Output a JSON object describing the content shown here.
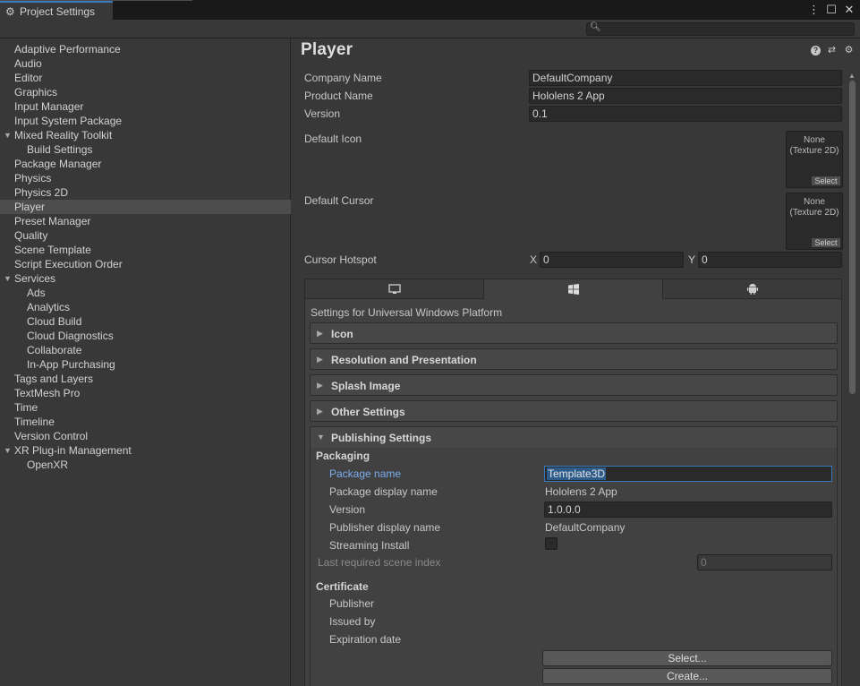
{
  "window": {
    "tab_title": "Project Settings",
    "controls": [
      "⋮",
      "☐",
      "✕"
    ]
  },
  "search": {
    "value": "",
    "placeholder": ""
  },
  "sidebar": {
    "items": [
      {
        "label": "Adaptive Performance",
        "indent": 0
      },
      {
        "label": "Audio",
        "indent": 0
      },
      {
        "label": "Editor",
        "indent": 0
      },
      {
        "label": "Graphics",
        "indent": 0
      },
      {
        "label": "Input Manager",
        "indent": 0
      },
      {
        "label": "Input System Package",
        "indent": 0
      },
      {
        "label": "Mixed Reality Toolkit",
        "indent": 0,
        "expanded": true
      },
      {
        "label": "Build Settings",
        "indent": 1
      },
      {
        "label": "Package Manager",
        "indent": 0
      },
      {
        "label": "Physics",
        "indent": 0
      },
      {
        "label": "Physics 2D",
        "indent": 0
      },
      {
        "label": "Player",
        "indent": 0,
        "selected": true
      },
      {
        "label": "Preset Manager",
        "indent": 0
      },
      {
        "label": "Quality",
        "indent": 0
      },
      {
        "label": "Scene Template",
        "indent": 0
      },
      {
        "label": "Script Execution Order",
        "indent": 0
      },
      {
        "label": "Services",
        "indent": 0,
        "expanded": true
      },
      {
        "label": "Ads",
        "indent": 1
      },
      {
        "label": "Analytics",
        "indent": 1
      },
      {
        "label": "Cloud Build",
        "indent": 1
      },
      {
        "label": "Cloud Diagnostics",
        "indent": 1
      },
      {
        "label": "Collaborate",
        "indent": 1
      },
      {
        "label": "In-App Purchasing",
        "indent": 1
      },
      {
        "label": "Tags and Layers",
        "indent": 0
      },
      {
        "label": "TextMesh Pro",
        "indent": 0
      },
      {
        "label": "Time",
        "indent": 0
      },
      {
        "label": "Timeline",
        "indent": 0
      },
      {
        "label": "Version Control",
        "indent": 0
      },
      {
        "label": "XR Plug-in Management",
        "indent": 0,
        "expanded": true
      },
      {
        "label": "OpenXR",
        "indent": 1
      }
    ]
  },
  "player": {
    "title": "Player",
    "company_name": {
      "label": "Company Name",
      "value": "DefaultCompany"
    },
    "product_name": {
      "label": "Product Name",
      "value": "Hololens 2 App"
    },
    "version": {
      "label": "Version",
      "value": "0.1"
    },
    "default_icon": {
      "label": "Default Icon",
      "value": "None\n(Texture 2D)",
      "select_label": "Select"
    },
    "default_cursor": {
      "label": "Default Cursor",
      "value": "None\n(Texture 2D)",
      "select_label": "Select"
    },
    "cursor_hotspot": {
      "label": "Cursor Hotspot",
      "x_label": "X",
      "x_value": "0",
      "y_label": "Y",
      "y_value": "0"
    }
  },
  "platform": {
    "heading": "Settings for Universal Windows Platform",
    "tabs": [
      "desktop-icon",
      "windows-icon",
      "android-icon"
    ],
    "sections": {
      "icon": "Icon",
      "resolution": "Resolution and Presentation",
      "splash": "Splash Image",
      "other": "Other Settings",
      "publishing": "Publishing Settings"
    }
  },
  "publishing": {
    "packaging": "Packaging",
    "package_name": {
      "label": "Package name",
      "value": "Template3D"
    },
    "package_display_name": {
      "label": "Package display name",
      "value": "Hololens 2 App"
    },
    "version": {
      "label": "Version",
      "value": "1.0.0.0"
    },
    "publisher_display_name": {
      "label": "Publisher display name",
      "value": "DefaultCompany"
    },
    "streaming_install": {
      "label": "Streaming Install",
      "checked": false
    },
    "last_scene_index": {
      "label": "Last required scene index",
      "value": "0"
    },
    "certificate": "Certificate",
    "publisher": "Publisher",
    "issued_by": "Issued by",
    "expiration_date": "Expiration date",
    "select_button": "Select...",
    "create_button": "Create..."
  }
}
